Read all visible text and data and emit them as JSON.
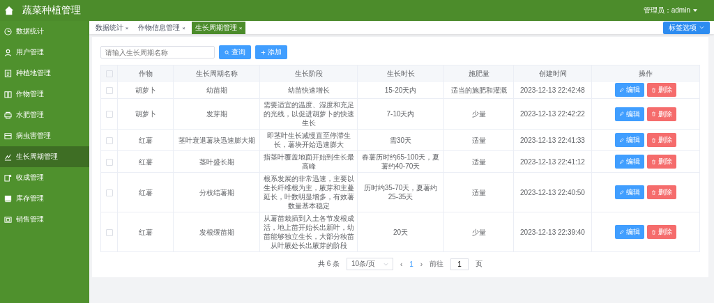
{
  "header": {
    "title": "蔬菜种植管理",
    "user": "管理员：admin"
  },
  "sidebar": {
    "items": [
      {
        "label": "数据统计",
        "selected": false
      },
      {
        "label": "用户管理",
        "selected": false
      },
      {
        "label": "种植地管理",
        "selected": false
      },
      {
        "label": "作物管理",
        "selected": false
      },
      {
        "label": "水肥管理",
        "selected": false
      },
      {
        "label": "病虫害管理",
        "selected": false
      },
      {
        "label": "生长周期管理",
        "selected": true
      },
      {
        "label": "收成管理",
        "selected": false
      },
      {
        "label": "库存管理",
        "selected": false
      },
      {
        "label": "销售管理",
        "selected": false
      }
    ]
  },
  "tabs": [
    {
      "label": "数据统计",
      "close": "×",
      "selected": false
    },
    {
      "label": "作物信息管理",
      "close": "×",
      "selected": false
    },
    {
      "label": "生长周期管理",
      "close": "×",
      "selected": true
    }
  ],
  "tab_options": "标签选项",
  "search": {
    "placeholder": "请输入生长周期名称",
    "search_button": "查询",
    "add_button": "添加"
  },
  "table": {
    "columns": [
      "作物",
      "生长周期名称",
      "生长阶段",
      "生长时长",
      "施肥量",
      "创建时间",
      "操作"
    ],
    "all_checked": false,
    "rows": [
      {
        "checked": false,
        "crop": "胡萝卜",
        "name": "幼苗期",
        "stage": "幼苗快速增长",
        "duration": "15-20天内",
        "fertilizer": "适当的施肥和灌溉",
        "created": "2023-12-13 22:42:48",
        "edit": "编辑",
        "delete": "删除"
      },
      {
        "checked": false,
        "crop": "胡萝卜",
        "name": "发芽期",
        "stage": "需要适宜的温度、湿度和充足的光线，以促进胡萝卜的快速生长",
        "duration": "7-10天内",
        "fertilizer": "少量",
        "created": "2023-12-13 22:42:22",
        "edit": "编辑",
        "delete": "删除"
      },
      {
        "checked": false,
        "crop": "红薯",
        "name": "茎叶衰退薯块迅速膨大期",
        "stage": "即茎叶生长减慢直至停滞生长，薯块开始迅速膨大",
        "duration": "需30天",
        "fertilizer": "适量",
        "created": "2023-12-13 22:41:33",
        "edit": "编辑",
        "delete": "删除"
      },
      {
        "checked": false,
        "crop": "红薯",
        "name": "茎叶盛长期",
        "stage": "指茎叶覆盖地面开始到生长最高峰",
        "duration": "春薯历时约65-100天，夏薯约40-70天",
        "fertilizer": "适量",
        "created": "2023-12-13 22:41:12",
        "edit": "编辑",
        "delete": "删除"
      },
      {
        "checked": false,
        "crop": "红薯",
        "name": "分枝结薯期",
        "stage": "根系发展的非常迅速，主要以生长纤维根为主，腋芽和主蔓延长，叶数明显增多，有效薯数量基本稳定",
        "duration": "历时约35-70天，夏薯约25-35天",
        "fertilizer": "适量",
        "created": "2023-12-13 22:40:50",
        "edit": "编辑",
        "delete": "删除"
      },
      {
        "checked": false,
        "crop": "红薯",
        "name": "发根缓苗期",
        "stage": "从薯苗栽插到入土各节发根成活，地上苗开始长出新叶，幼苗能够独立生长，大部分秧苗从叶腋处长出腋芽的阶段",
        "duration": "20天",
        "fertilizer": "少量",
        "created": "2023-12-13 22:39:40",
        "edit": "编辑",
        "delete": "删除"
      }
    ]
  },
  "pagination": {
    "total": "共 6 条",
    "page_size": "10条/页",
    "prev": "‹",
    "current": "1",
    "next": "›",
    "goto_label": "前往",
    "goto_value": "1",
    "goto_suffix": "页"
  }
}
